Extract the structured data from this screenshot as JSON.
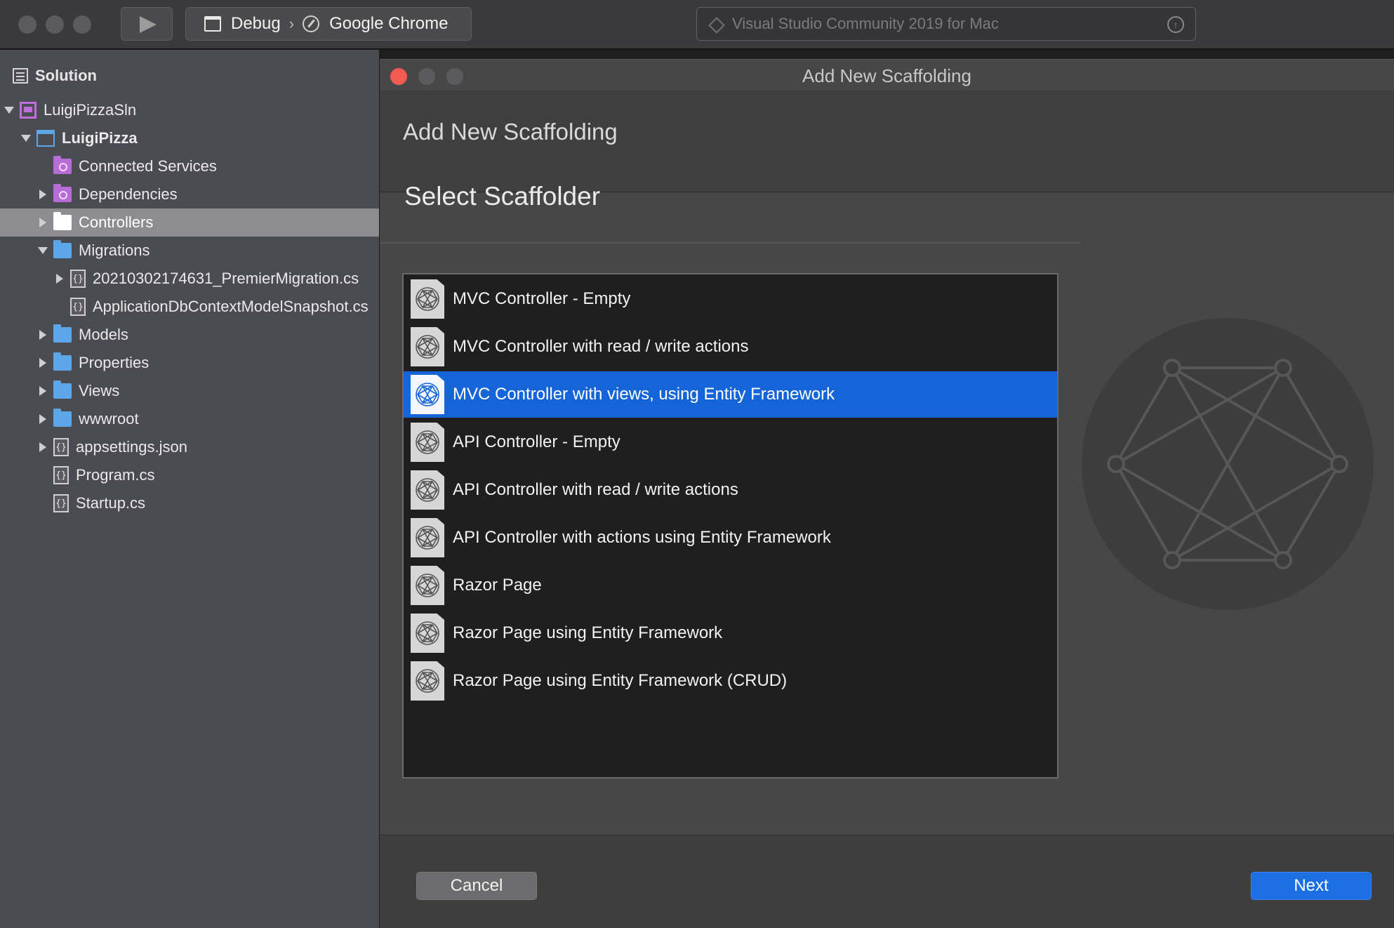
{
  "toolbar": {
    "config": "Debug",
    "separator": "›",
    "target": "Google Chrome",
    "status": "Visual Studio Community 2019 for Mac"
  },
  "sidebar": {
    "header": "Solution",
    "items": [
      {
        "label": "LuigiPizzaSln",
        "icon": "solution-icon",
        "expanded": true
      },
      {
        "label": "LuigiPizza",
        "icon": "project-icon",
        "expanded": true,
        "bold": true
      },
      {
        "label": "Connected Services",
        "icon": "connected-services-icon"
      },
      {
        "label": "Dependencies",
        "icon": "dependencies-icon",
        "expanded": false
      },
      {
        "label": "Controllers",
        "icon": "folder-icon",
        "expanded": false,
        "selected": true
      },
      {
        "label": "Migrations",
        "icon": "folder-icon",
        "expanded": true
      },
      {
        "label": "20210302174631_PremierMigration.cs",
        "icon": "code-file-icon",
        "expanded": false
      },
      {
        "label": "ApplicationDbContextModelSnapshot.cs",
        "icon": "code-file-icon"
      },
      {
        "label": "Models",
        "icon": "folder-icon",
        "expanded": false
      },
      {
        "label": "Properties",
        "icon": "folder-icon",
        "expanded": false
      },
      {
        "label": "Views",
        "icon": "folder-icon",
        "expanded": false
      },
      {
        "label": "wwwroot",
        "icon": "folder-icon",
        "expanded": false
      },
      {
        "label": "appsettings.json",
        "icon": "json-file-icon",
        "expanded": false
      },
      {
        "label": "Program.cs",
        "icon": "code-file-icon"
      },
      {
        "label": "Startup.cs",
        "icon": "code-file-icon"
      }
    ]
  },
  "dialog": {
    "window_title": "Add New Scaffolding",
    "header_title": "Add New Scaffolding",
    "section_title": "Select Scaffolder",
    "scaffolders": [
      {
        "label": "MVC Controller - Empty"
      },
      {
        "label": "MVC Controller with read / write actions"
      },
      {
        "label": "MVC Controller with views, using Entity Framework",
        "selected": true
      },
      {
        "label": "API Controller - Empty"
      },
      {
        "label": "API Controller with read / write actions"
      },
      {
        "label": "API Controller with actions using Entity Framework"
      },
      {
        "label": "Razor Page"
      },
      {
        "label": "Razor Page using Entity Framework"
      },
      {
        "label": "Razor Page using Entity Framework (CRUD)"
      }
    ],
    "cancel_label": "Cancel",
    "next_label": "Next"
  },
  "colors": {
    "selection_blue": "#1565d8",
    "next_button": "#1b6fe0",
    "close_red": "#f25a52",
    "folder_blue": "#5da6e8",
    "solution_purple": "#c16de0"
  }
}
